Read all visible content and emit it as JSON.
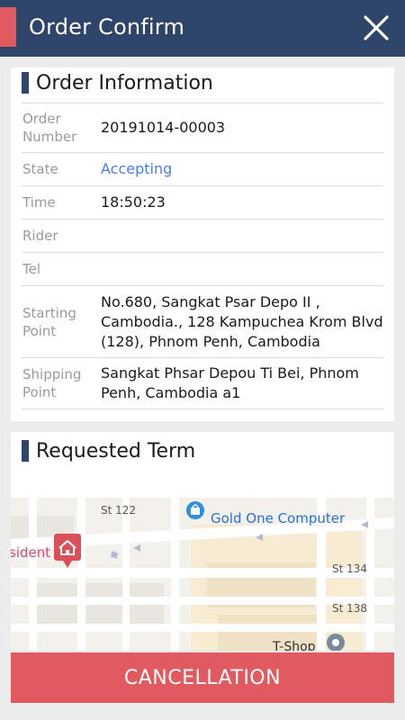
{
  "header": {
    "title": "Order Confirm"
  },
  "order_info": {
    "title": "Order Information",
    "rows": [
      {
        "label": "Order Number",
        "value": "20191014-00003"
      },
      {
        "label": "State",
        "value": "Accepting"
      },
      {
        "label": "Time",
        "value": "18:50:23"
      },
      {
        "label": "Rider",
        "value": ""
      },
      {
        "label": "Tel",
        "value": ""
      },
      {
        "label": "Starting Point",
        "value": "No.680, Sangkat Psar Depo II , Cambodia., 128 Kampuchea Krom Blvd (128), Phnom Penh, Cambodia"
      },
      {
        "label": "Shipping Point",
        "value": "Sangkat Phsar Depou Ti Bei, Phnom Penh, Cambodia  a1"
      }
    ]
  },
  "requested_term": {
    "title": "Requested Term"
  },
  "map": {
    "street_122": "St 122",
    "poi_gold_one": "Gold One Computer",
    "street_134": "St 134",
    "street_138": "St 138",
    "poi_tshop": "T-Shop",
    "residence_fragment": "sident"
  },
  "footer": {
    "cancel_label": "CANCELLATION"
  },
  "colors": {
    "header": "#2e4468",
    "accent": "#e05a5f",
    "state": "#4a7de0"
  }
}
